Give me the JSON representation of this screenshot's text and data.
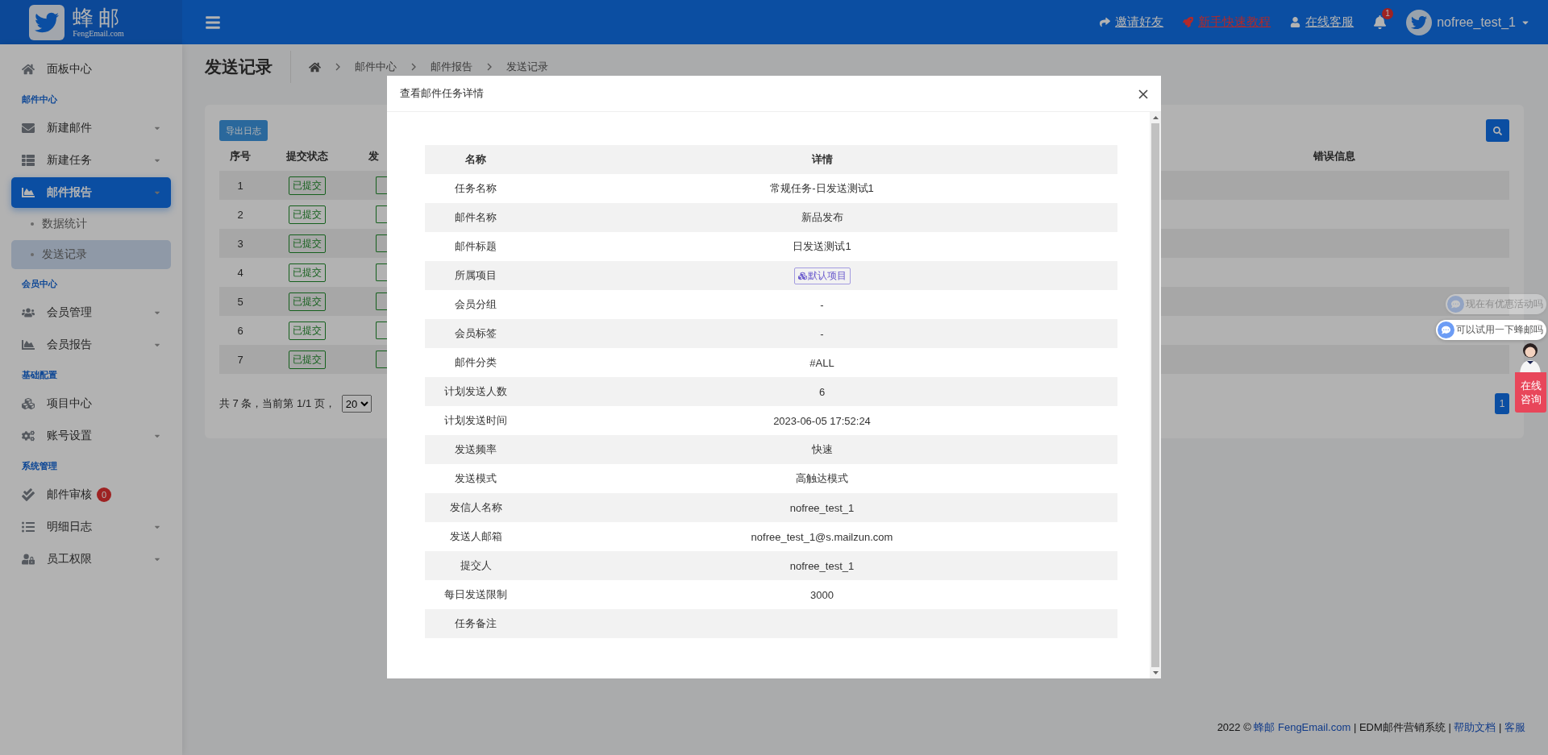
{
  "header": {
    "logo_title": "蜂邮",
    "logo_subtitle": "FengEmail.com",
    "links": [
      {
        "label": "邀请好友",
        "highlight": false
      },
      {
        "label": "新手快速教程",
        "highlight": true
      },
      {
        "label": "在线客服",
        "highlight": false
      }
    ],
    "notification_count": "1",
    "username": "nofree_test_1"
  },
  "sidebar": {
    "items": [
      {
        "kind": "item",
        "label": "面板中心",
        "has_submenu": false,
        "selected": false
      },
      {
        "kind": "heading",
        "label": "邮件中心"
      },
      {
        "kind": "item",
        "label": "新建邮件",
        "has_submenu": true,
        "selected": false
      },
      {
        "kind": "item",
        "label": "新建任务",
        "has_submenu": true,
        "selected": false
      },
      {
        "kind": "item",
        "label": "邮件报告",
        "has_submenu": true,
        "selected": true
      },
      {
        "kind": "subitem",
        "label": "数据统计",
        "selected": false
      },
      {
        "kind": "subitem",
        "label": "发送记录",
        "selected": true
      },
      {
        "kind": "heading",
        "label": "会员中心"
      },
      {
        "kind": "item",
        "label": "会员管理",
        "has_submenu": true,
        "selected": false
      },
      {
        "kind": "item",
        "label": "会员报告",
        "has_submenu": true,
        "selected": false
      },
      {
        "kind": "heading",
        "label": "基础配置"
      },
      {
        "kind": "item",
        "label": "项目中心",
        "has_submenu": false,
        "selected": false
      },
      {
        "kind": "item",
        "label": "账号设置",
        "has_submenu": true,
        "selected": false
      },
      {
        "kind": "heading",
        "label": "系统管理"
      },
      {
        "kind": "item",
        "label": "邮件审核",
        "has_submenu": false,
        "selected": false,
        "badge": "0"
      },
      {
        "kind": "item",
        "label": "明细日志",
        "has_submenu": true,
        "selected": false
      },
      {
        "kind": "item",
        "label": "员工权限",
        "has_submenu": true,
        "selected": false
      }
    ]
  },
  "page": {
    "title": "发送记录",
    "breadcrumb": [
      "邮件中心",
      "邮件报告",
      "发送记录"
    ]
  },
  "table": {
    "export_button": "导出日志",
    "columns": [
      "序号",
      "提交状态",
      "发",
      "错误信息"
    ],
    "rows": [
      {
        "index": "1",
        "status": "已提交"
      },
      {
        "index": "2",
        "status": "已提交"
      },
      {
        "index": "3",
        "status": "已提交"
      },
      {
        "index": "4",
        "status": "已提交"
      },
      {
        "index": "5",
        "status": "已提交"
      },
      {
        "index": "6",
        "status": "已提交"
      },
      {
        "index": "7",
        "status": "已提交"
      }
    ],
    "summary": "共 7 条，当前第 1/1 页，",
    "page_size": "20",
    "pages": [
      {
        "label": "1",
        "selected": true
      }
    ]
  },
  "footer": [
    {
      "text": "2022 © ",
      "link": false
    },
    {
      "text": "蜂邮 FengEmail.com",
      "link": true
    },
    {
      "text": " | EDM邮件营销系统 | ",
      "link": false
    },
    {
      "text": "帮助文档",
      "link": true
    },
    {
      "text": " | ",
      "link": false
    },
    {
      "text": "客服",
      "link": true
    }
  ],
  "chat": {
    "bubbles": [
      {
        "text": "现在有优惠活动吗",
        "faded": true
      },
      {
        "text": "可以试用一下蜂邮吗",
        "faded": false
      }
    ],
    "consult": "在线咨询"
  },
  "modal": {
    "title": "查看邮件任务详情",
    "columns": [
      "名称",
      "详情"
    ],
    "rows": [
      {
        "name": "任务名称",
        "detail": "常规任务-日发送测试1",
        "kind": "text"
      },
      {
        "name": "邮件名称",
        "detail": "新品发布",
        "kind": "text"
      },
      {
        "name": "邮件标题",
        "detail": "日发送测试1",
        "kind": "text"
      },
      {
        "name": "所属项目",
        "detail": "默认项目",
        "kind": "tag"
      },
      {
        "name": "会员分组",
        "detail": "-",
        "kind": "text"
      },
      {
        "name": "会员标签",
        "detail": "-",
        "kind": "text"
      },
      {
        "name": "邮件分类",
        "detail": "#ALL",
        "kind": "text"
      },
      {
        "name": "计划发送人数",
        "detail": "6",
        "kind": "text"
      },
      {
        "name": "计划发送时间",
        "detail": "2023-06-05 17:52:24",
        "kind": "text"
      },
      {
        "name": "发送频率",
        "detail": "快速",
        "kind": "text"
      },
      {
        "name": "发送模式",
        "detail": "高触达模式",
        "kind": "text"
      },
      {
        "name": "发信人名称",
        "detail": "nofree_test_1",
        "kind": "text"
      },
      {
        "name": "发送人邮箱",
        "detail": "nofree_test_1@s.mailzun.com",
        "kind": "text"
      },
      {
        "name": "提交人",
        "detail": "nofree_test_1",
        "kind": "text"
      },
      {
        "name": "每日发送限制",
        "detail": "3000",
        "kind": "text"
      },
      {
        "name": "任务备注",
        "kind": "text"
      }
    ]
  }
}
